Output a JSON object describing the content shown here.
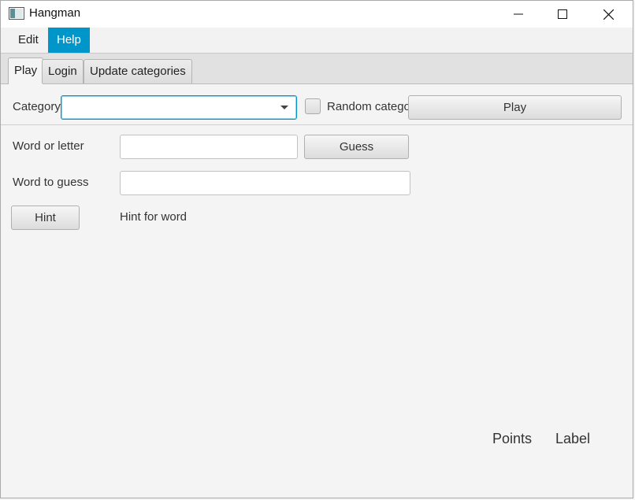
{
  "window": {
    "title": "Hangman"
  },
  "menubar": {
    "items": [
      {
        "label": "Edit"
      },
      {
        "label": "Help"
      }
    ]
  },
  "tabs": [
    {
      "label": "Play"
    },
    {
      "label": "Login"
    },
    {
      "label": "Update categories"
    }
  ],
  "play": {
    "category_label": "Category",
    "category_value": "",
    "random_category_label": "Random category",
    "random_category_checked": false,
    "play_button": "Play",
    "word_or_letter_label": "Word or letter",
    "word_or_letter_value": "",
    "guess_button": "Guess",
    "word_to_guess_label": "Word to guess",
    "word_to_guess_value": "",
    "hint_button": "Hint",
    "hint_text": "Hint for word",
    "points_label": "Points",
    "score_label": "Label"
  },
  "colors": {
    "accent": "#0096c9"
  }
}
